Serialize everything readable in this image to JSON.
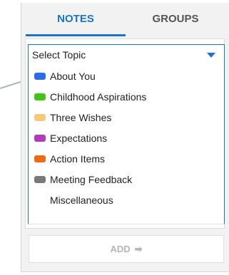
{
  "tabs": {
    "notes": "NOTES",
    "groups": "GROUPS"
  },
  "topic_select": {
    "selected": "Select Topic",
    "caret_icon": "caret-down-icon"
  },
  "topics": [
    {
      "label": "About You",
      "color": "#2d6ee8"
    },
    {
      "label": "Childhood Aspirations",
      "color": "#44c41a"
    },
    {
      "label": "Three Wishes",
      "color": "#f6c97a"
    },
    {
      "label": "Expectations",
      "color": "#b03ab8"
    },
    {
      "label": "Action Items",
      "color": "#ee6a14"
    },
    {
      "label": "Meeting Feedback",
      "color": "#7a7a7a"
    },
    {
      "label": "Miscellaneous",
      "color": ""
    }
  ],
  "add_button": {
    "label": "ADD",
    "icon": "arrow-right-icon"
  },
  "colors": {
    "accent": "#1a74c8",
    "panel_bg": "#f2f2f2"
  }
}
